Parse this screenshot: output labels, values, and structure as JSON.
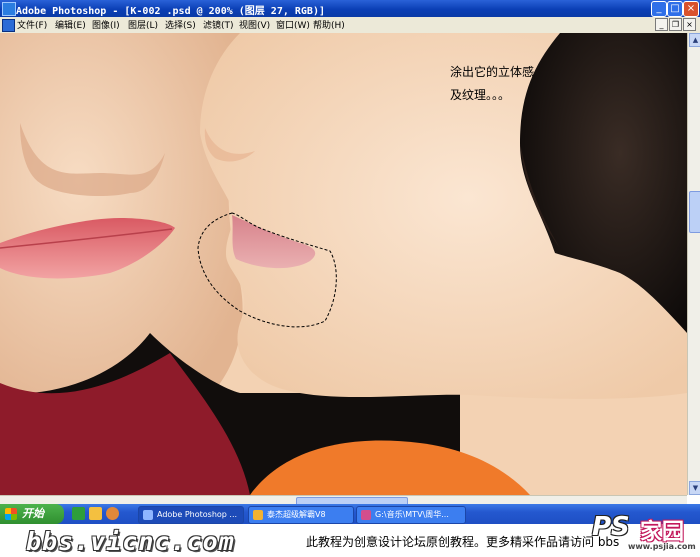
{
  "window": {
    "title": "Adobe Photoshop - [K-002 .psd @ 200% (图层 27, RGB)]",
    "buttons": {
      "minimize": "_",
      "maximize": "□",
      "close": "×"
    }
  },
  "menu": {
    "items": [
      "文件(F)",
      "编辑(E)",
      "图像(I)",
      "图层(L)",
      "选择(S)",
      "滤镜(T)",
      "视图(V)",
      "窗口(W)",
      "帮助(H)"
    ],
    "doc_controls": {
      "minimize": "_",
      "restore": "❐",
      "close": "×"
    }
  },
  "canvas": {
    "annotation_line1": "涂出它的立体感",
    "annotation_line2": "及纹理。。。"
  },
  "taskbar": {
    "start_label": "开始",
    "tasks": [
      "Adobe Photoshop ...",
      "泰杰超级解霸V8",
      "G:\\音乐\\MTV\\周华..."
    ]
  },
  "footer": {
    "site": "bbs.vicnc.com",
    "caption": "此教程为创意设计论坛原创教程。更多精采作品请访问 bbs",
    "logo_ps": "PS",
    "logo_jia": "家园",
    "logo_url": "www.psjia.com"
  },
  "colors": {
    "titlebar": "#0b3fb5",
    "menubar": "#ece9d8",
    "skin": "#f3d2b3",
    "lips_red": "#e06a6f",
    "lips_pink": "#e59aa0",
    "hair": "#1a1412",
    "shirt_red": "#8e1b2a",
    "shirt_orange": "#f07a2a"
  }
}
